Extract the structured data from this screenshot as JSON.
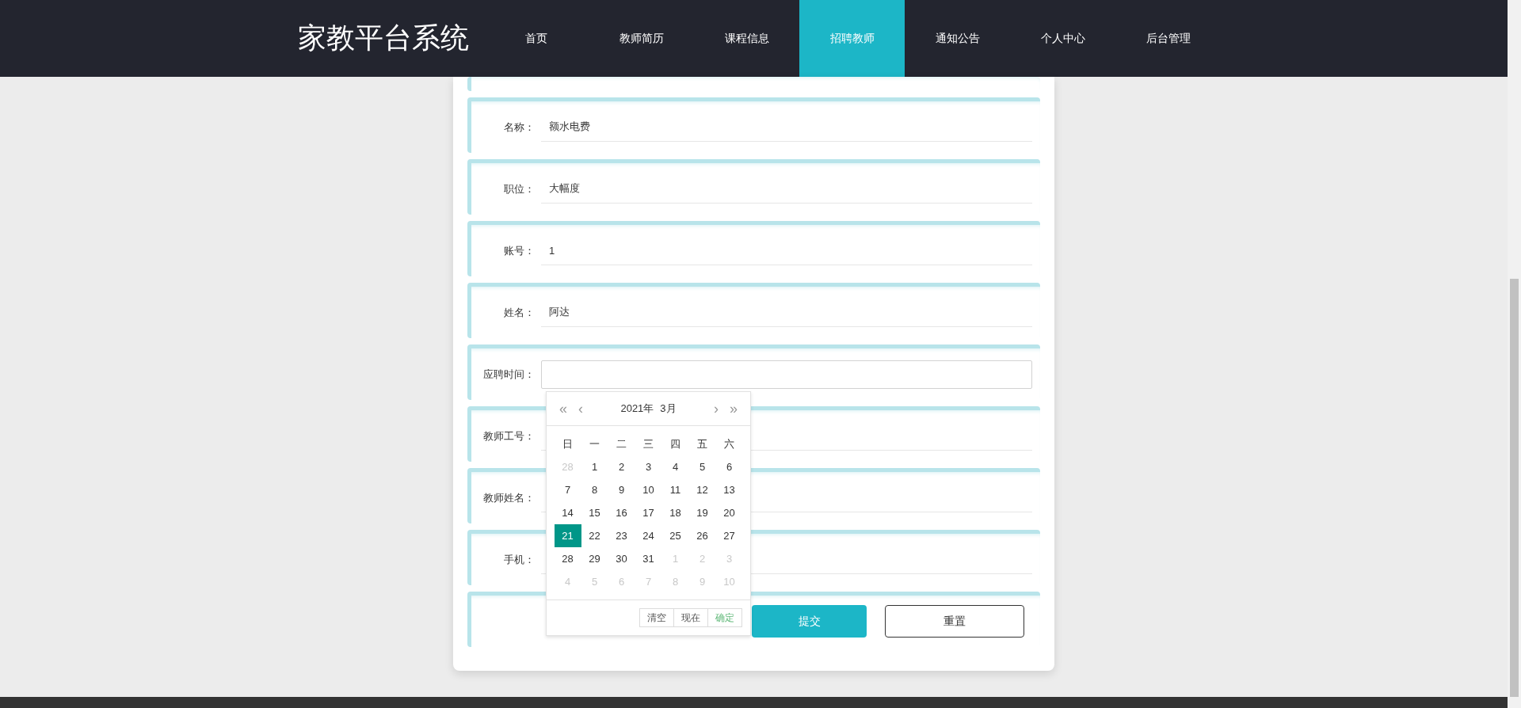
{
  "header": {
    "title": "家教平台系统",
    "nav": [
      {
        "label": "首页",
        "selected": false
      },
      {
        "label": "教师简历",
        "selected": false
      },
      {
        "label": "课程信息",
        "selected": false
      },
      {
        "label": "招聘教师",
        "selected": true
      },
      {
        "label": "通知公告",
        "selected": false
      },
      {
        "label": "个人中心",
        "selected": false
      },
      {
        "label": "后台管理",
        "selected": false
      }
    ]
  },
  "form": {
    "fields": [
      {
        "label": "名称：",
        "value": "额水电费",
        "kind": "text"
      },
      {
        "label": "职位：",
        "value": "大幅度",
        "kind": "text"
      },
      {
        "label": "账号：",
        "value": "1",
        "kind": "text"
      },
      {
        "label": "姓名：",
        "value": "阿达",
        "kind": "text"
      },
      {
        "label": "应聘时间：",
        "kind": "date"
      },
      {
        "label": "教师工号：",
        "kind": "text"
      },
      {
        "label": "教师姓名：",
        "kind": "text"
      },
      {
        "label": "手机：",
        "kind": "text"
      }
    ],
    "buttons": [
      {
        "label": "提交",
        "kind": "primary"
      },
      {
        "label": "重置",
        "kind": "outline"
      }
    ]
  },
  "date_picker": {
    "prev_year": "«",
    "prev_month": "‹",
    "year": "2021年",
    "month": "3月",
    "next_month": "›",
    "next_year": "»",
    "weekdays": [
      "日",
      "一",
      "二",
      "三",
      "四",
      "五",
      "六"
    ],
    "days": [
      {
        "label": "28",
        "other_month": true,
        "selected": false
      },
      {
        "label": "1",
        "other_month": false,
        "selected": false
      },
      {
        "label": "2",
        "other_month": false,
        "selected": false
      },
      {
        "label": "3",
        "other_month": false,
        "selected": false
      },
      {
        "label": "4",
        "other_month": false,
        "selected": false
      },
      {
        "label": "5",
        "other_month": false,
        "selected": false
      },
      {
        "label": "6",
        "other_month": false,
        "selected": false
      },
      {
        "label": "7",
        "other_month": false,
        "selected": false
      },
      {
        "label": "8",
        "other_month": false,
        "selected": false
      },
      {
        "label": "9",
        "other_month": false,
        "selected": false
      },
      {
        "label": "10",
        "other_month": false,
        "selected": false
      },
      {
        "label": "11",
        "other_month": false,
        "selected": false
      },
      {
        "label": "12",
        "other_month": false,
        "selected": false
      },
      {
        "label": "13",
        "other_month": false,
        "selected": false
      },
      {
        "label": "14",
        "other_month": false,
        "selected": false
      },
      {
        "label": "15",
        "other_month": false,
        "selected": false
      },
      {
        "label": "16",
        "other_month": false,
        "selected": false
      },
      {
        "label": "17",
        "other_month": false,
        "selected": false
      },
      {
        "label": "18",
        "other_month": false,
        "selected": false
      },
      {
        "label": "19",
        "other_month": false,
        "selected": false
      },
      {
        "label": "20",
        "other_month": false,
        "selected": false
      },
      {
        "label": "21",
        "other_month": false,
        "selected": true
      },
      {
        "label": "22",
        "other_month": false,
        "selected": false
      },
      {
        "label": "23",
        "other_month": false,
        "selected": false
      },
      {
        "label": "24",
        "other_month": false,
        "selected": false
      },
      {
        "label": "25",
        "other_month": false,
        "selected": false
      },
      {
        "label": "26",
        "other_month": false,
        "selected": false
      },
      {
        "label": "27",
        "other_month": false,
        "selected": false
      },
      {
        "label": "28",
        "other_month": false,
        "selected": false
      },
      {
        "label": "29",
        "other_month": false,
        "selected": false
      },
      {
        "label": "30",
        "other_month": false,
        "selected": false
      },
      {
        "label": "31",
        "other_month": false,
        "selected": false
      },
      {
        "label": "1",
        "other_month": true,
        "selected": false
      },
      {
        "label": "2",
        "other_month": true,
        "selected": false
      },
      {
        "label": "3",
        "other_month": true,
        "selected": false
      },
      {
        "label": "4",
        "other_month": true,
        "selected": false
      },
      {
        "label": "5",
        "other_month": true,
        "selected": false
      },
      {
        "label": "6",
        "other_month": true,
        "selected": false
      },
      {
        "label": "7",
        "other_month": true,
        "selected": false
      },
      {
        "label": "8",
        "other_month": true,
        "selected": false
      },
      {
        "label": "9",
        "other_month": true,
        "selected": false
      },
      {
        "label": "10",
        "other_month": true,
        "selected": false
      }
    ],
    "buttons": [
      {
        "label": "清空",
        "kind": "plain"
      },
      {
        "label": "现在",
        "kind": "plain"
      },
      {
        "label": "确定",
        "kind": "confirm"
      }
    ]
  }
}
